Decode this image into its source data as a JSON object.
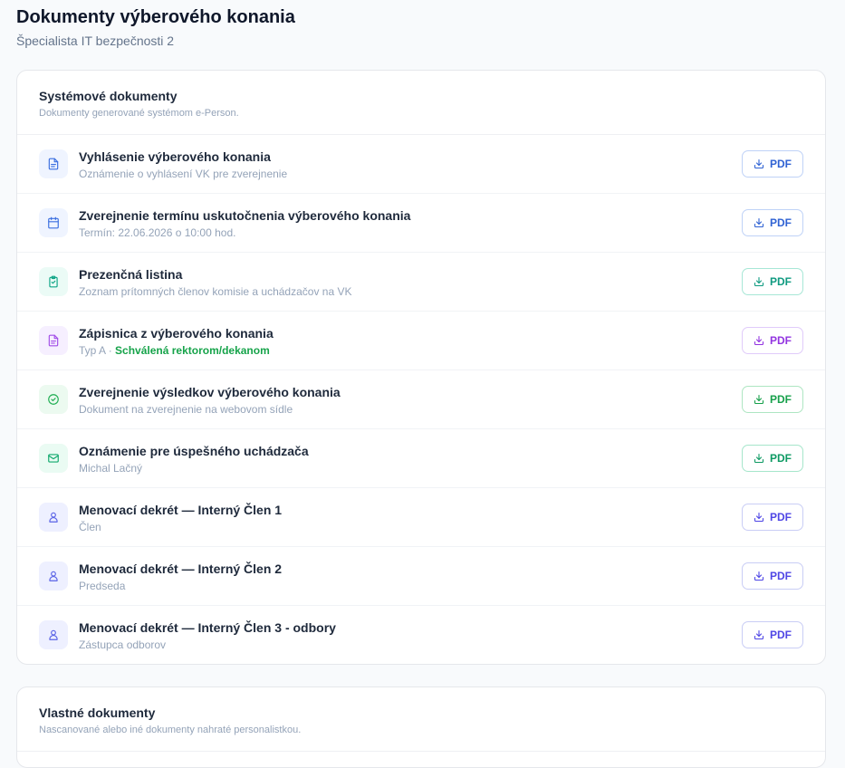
{
  "page": {
    "title": "Dokumenty výberového konania",
    "subtitle": "Špecialista IT bezpečnosti 2"
  },
  "system_docs": {
    "title": "Systémové dokumenty",
    "description": "Dokumenty generované systémom e-Person.",
    "items": [
      {
        "title": "Vyhlásenie výberového konania",
        "subtitle": "Oznámenie o vyhlásení VK pre zverejnenie",
        "icon": "file-text-icon",
        "button": "PDF"
      },
      {
        "title": "Zverejnenie termínu uskutočnenia výberového konania",
        "subtitle": "Termín: 22.06.2026 o 10:00 hod.",
        "icon": "calendar-icon",
        "button": "PDF"
      },
      {
        "title": "Prezenčná listina",
        "subtitle": "Zoznam prítomných členov komisie a uchádzačov na VK",
        "icon": "clipboard-check-icon",
        "button": "PDF"
      },
      {
        "title": "Zápisnica z výberového konania",
        "subtitle": "Typ A ·",
        "subtitle_status": "Schválená rektorom/dekanom",
        "icon": "file-text-icon",
        "button": "PDF"
      },
      {
        "title": "Zverejnenie výsledkov výberového konania",
        "subtitle": "Dokument na zverejnenie na webovom sídle",
        "icon": "check-circle-icon",
        "button": "PDF"
      },
      {
        "title": "Oznámenie pre úspešného uchádzača",
        "subtitle": "Michal Lačný",
        "icon": "mail-icon",
        "button": "PDF"
      },
      {
        "title": "Menovací dekrét — Interný Člen 1",
        "subtitle": "Člen",
        "icon": "user-icon",
        "button": "PDF"
      },
      {
        "title": "Menovací dekrét — Interný Člen 2",
        "subtitle": "Predseda",
        "icon": "user-icon",
        "button": "PDF"
      },
      {
        "title": "Menovací dekrét — Interný Člen 3 - odbory",
        "subtitle": "Zástupca odborov",
        "icon": "user-icon",
        "button": "PDF"
      }
    ]
  },
  "custom_docs": {
    "title": "Vlastné dokumenty",
    "description": "Nascanované alebo iné dokumenty nahraté personalistkou."
  },
  "colors": {
    "blue": "#2f62d3",
    "teal": "#0f9a80",
    "purple": "#9234e0",
    "green": "#16a34a",
    "emerald": "#0e9a63",
    "indigo": "#4f46e5"
  }
}
